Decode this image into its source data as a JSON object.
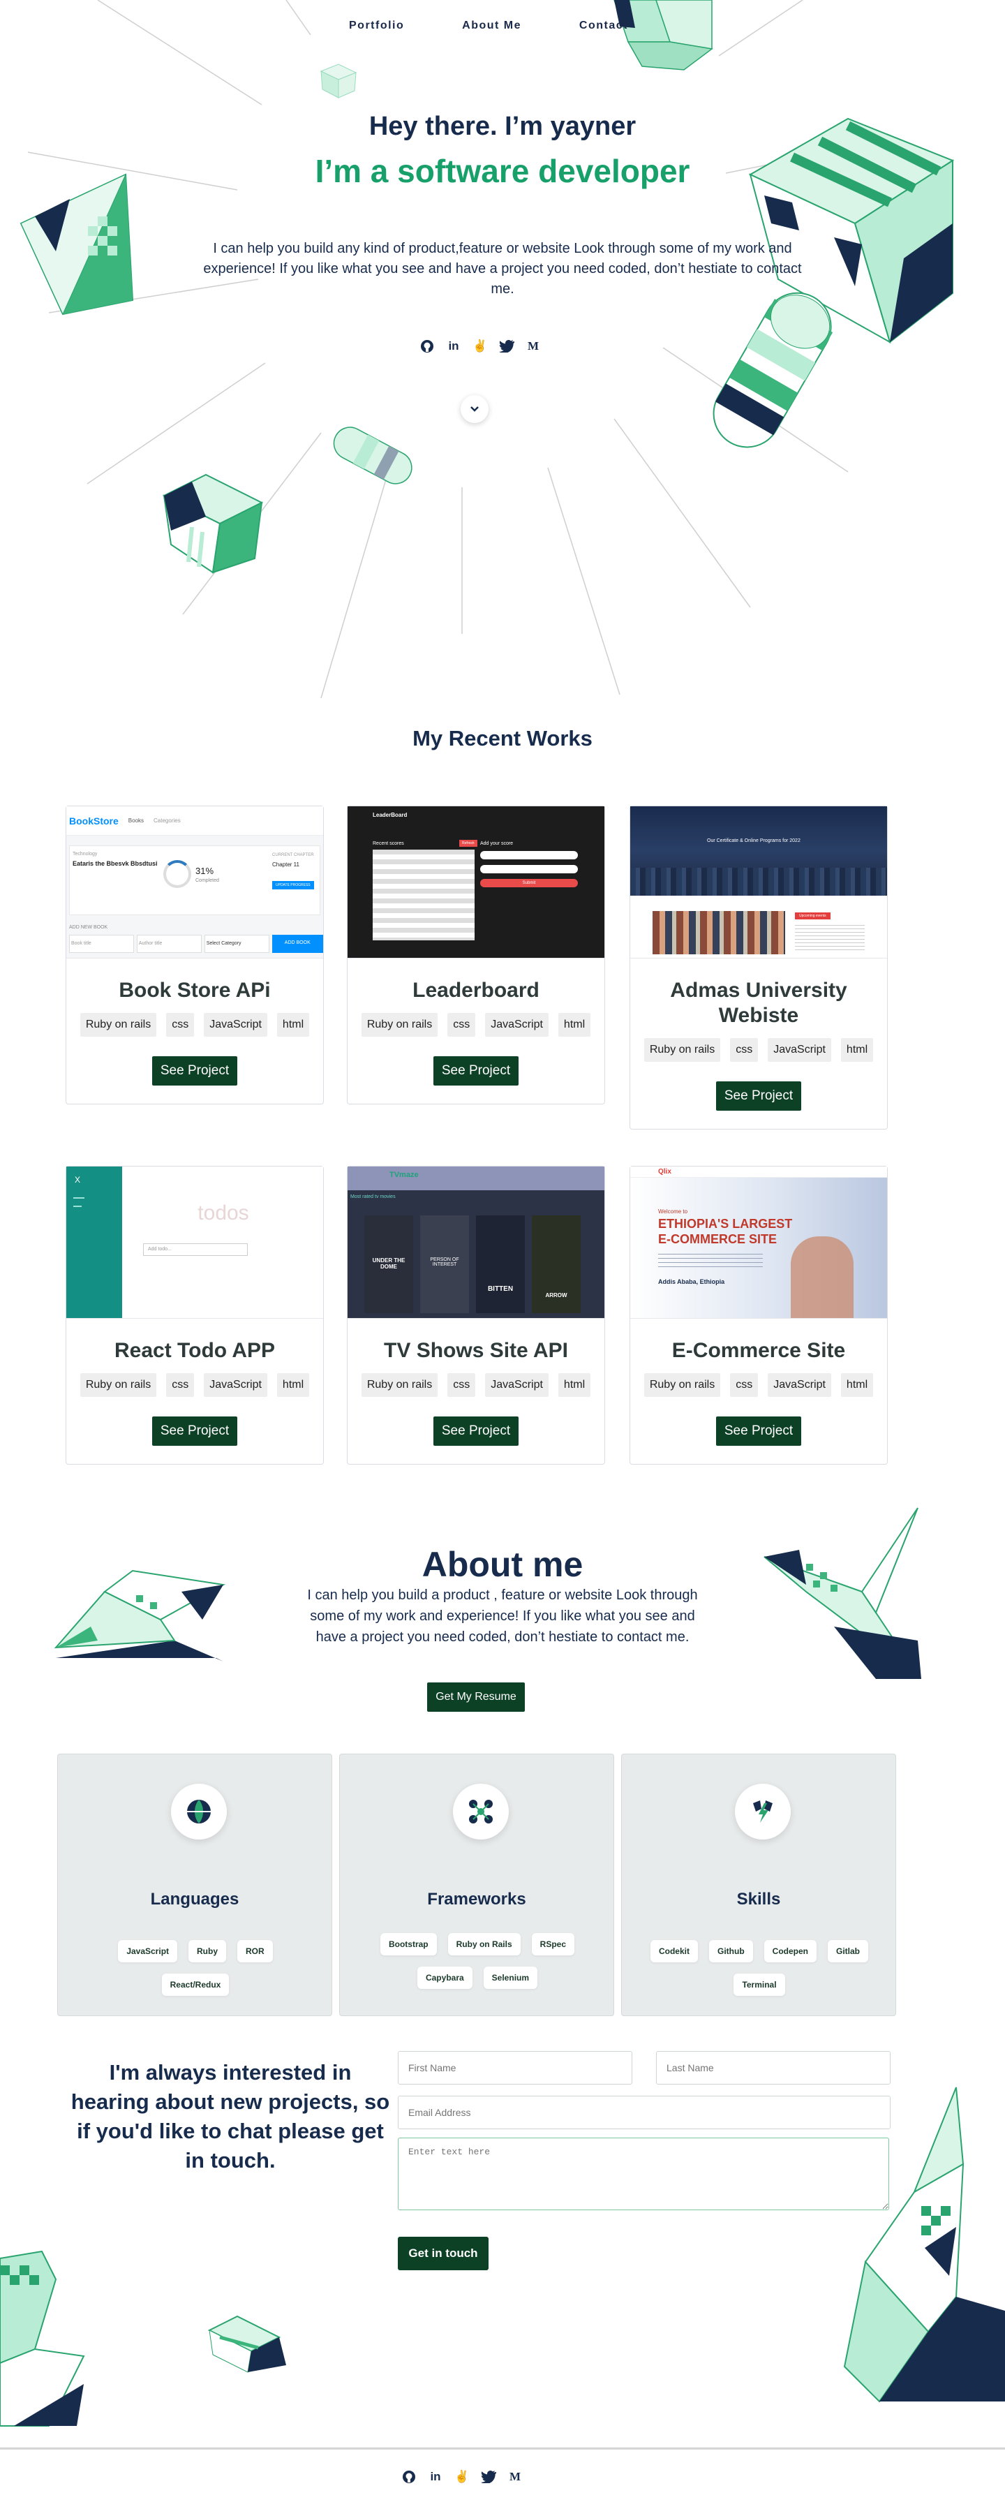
{
  "nav": {
    "items": [
      "Portfolio",
      "About Me",
      "Contact"
    ]
  },
  "hero": {
    "greeting": "Hey there. I’m yayner",
    "role": "I’m a software developer",
    "intro": "I can help you build any kind of product,feature or website Look through some of my work and experience! If you like what you see and have a project you need coded, don’t hestiate to contact me.",
    "social_icons": [
      "github-icon",
      "linkedin-icon",
      "angellist-icon",
      "twitter-icon",
      "medium-icon"
    ],
    "scroll_icon": "chevron-down-icon"
  },
  "works": {
    "title": "My Recent Works",
    "button_label": "See Project",
    "projects": [
      {
        "name": "Book Store APi",
        "tags": [
          "Ruby on rails",
          "css",
          "JavaScript",
          "html"
        ]
      },
      {
        "name": "Leaderboard",
        "tags": [
          "Ruby on rails",
          "css",
          "JavaScript",
          "html"
        ]
      },
      {
        "name": "Admas University Webiste",
        "tags": [
          "Ruby on rails",
          "css",
          "JavaScript",
          "html"
        ]
      },
      {
        "name": "React Todo APP",
        "tags": [
          "Ruby on rails",
          "css",
          "JavaScript",
          "html"
        ]
      },
      {
        "name": "TV Shows Site API",
        "tags": [
          "Ruby on rails",
          "css",
          "JavaScript",
          "html"
        ]
      },
      {
        "name": "E-Commerce Site",
        "tags": [
          "Ruby on rails",
          "css",
          "JavaScript",
          "html"
        ]
      }
    ],
    "thumbs": {
      "bookstore": {
        "logo": "BookStore",
        "nav1": "Books",
        "nav2": "Categories",
        "genre": "Technology",
        "book": "Eataris the Bbesvk Bbsdtusi",
        "pct": "31%",
        "pct_label": "Completed",
        "chapter": "CURRENT CHAPTER",
        "chapter_val": "Chapter 11",
        "progress_btn": "UPDATE PROGRESS",
        "add": "ADD NEW BOOK",
        "title_ph": "Book title",
        "author_ph": "Author title",
        "cat_ph": "Select Category",
        "add_btn": "ADD BOOK"
      },
      "leaderboard": {
        "brand": "LeaderBoard",
        "recent": "Recent scores",
        "refresh": "Refresh",
        "add": "Add your score",
        "submit": "Submit"
      },
      "admas": {
        "headline": "Our Certificate & Online Programs for 2022",
        "upcoming": "Upcoming events"
      },
      "todo": {
        "close": "X",
        "word": "todos",
        "add_ph": "Add todo..."
      },
      "tvshows": {
        "brand": "TVmaze",
        "section": "Most rated tv movies",
        "posters": [
          "UNDER THE DOME",
          "PERSON OF INTEREST",
          "BITTEN",
          "ARROW"
        ]
      },
      "ecommerce": {
        "logo": "Qlix",
        "welcome": "Welcome to",
        "line1": "ETHIOPIA'S LARGEST",
        "line2": "E-COMMERCE SITE",
        "city": "Addis Ababa, Ethiopia"
      }
    }
  },
  "about": {
    "title": "About me",
    "text": "I can help you build a product , feature or website Look through some of my work and experience! If you like what you see and have a project you need coded, don’t hestiate to contact me.",
    "resume_label": "Get My Resume"
  },
  "skills": [
    {
      "title": "Languages",
      "icon": "globe-icon",
      "items": [
        "JavaScript",
        "Ruby",
        "ROR",
        "React/Redux"
      ]
    },
    {
      "title": "Frameworks",
      "icon": "network-icon",
      "items": [
        "Bootstrap",
        "Ruby on Rails",
        "RSpec",
        "Capybara",
        "Selenium"
      ]
    },
    {
      "title": "Skills",
      "icon": "lightning-icon",
      "items": [
        "Codekit",
        "Github",
        "Codepen",
        "Gitlab",
        "Terminal"
      ]
    }
  ],
  "contact": {
    "heading": "I'm always interested in hearing about new projects, so if you'd like to chat please get in touch.",
    "first_name_ph": "First Name",
    "last_name_ph": "Last Name",
    "email_ph": "Email Address",
    "message_ph": "Enter text here",
    "submit_label": "Get in touch"
  },
  "colors": {
    "navy": "#172b4d",
    "green": "#17a06a",
    "dark_green": "#0d4126",
    "mint": "#b8ecd5"
  }
}
